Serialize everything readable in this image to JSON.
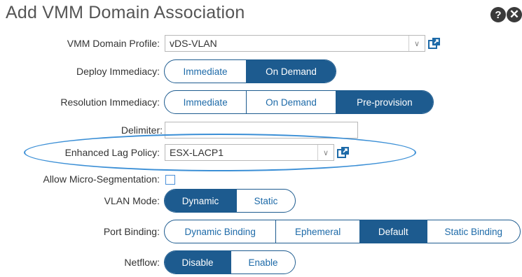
{
  "dialog": {
    "title": "Add VMM Domain Association",
    "help_icon": "question-icon",
    "close_icon": "close-icon"
  },
  "fields": {
    "vmm_domain_profile": {
      "label": "VMM Domain Profile:",
      "value": "vDS-VLAN"
    },
    "deploy_immediacy": {
      "label": "Deploy Immediacy:",
      "options": [
        "Immediate",
        "On Demand"
      ],
      "selected": "On Demand"
    },
    "resolution_immediacy": {
      "label": "Resolution Immediacy:",
      "options": [
        "Immediate",
        "On Demand",
        "Pre-provision"
      ],
      "selected": "Pre-provision"
    },
    "delimiter": {
      "label": "Delimiter:",
      "value": ""
    },
    "enhanced_lag_policy": {
      "label": "Enhanced Lag Policy:",
      "value": "ESX-LACP1"
    },
    "allow_micro_segmentation": {
      "label": "Allow Micro-Segmentation:",
      "checked": false
    },
    "vlan_mode": {
      "label": "VLAN Mode:",
      "options": [
        "Dynamic",
        "Static"
      ],
      "selected": "Dynamic"
    },
    "port_binding": {
      "label": "Port Binding:",
      "options": [
        "Dynamic Binding",
        "Ephemeral",
        "Default",
        "Static Binding"
      ],
      "selected": "Default"
    },
    "netflow": {
      "label": "Netflow:",
      "options": [
        "Disable",
        "Enable"
      ],
      "selected": "Disable"
    }
  },
  "colors": {
    "accent": "#1d5b8f",
    "highlight_ring": "#3b8fd6"
  }
}
